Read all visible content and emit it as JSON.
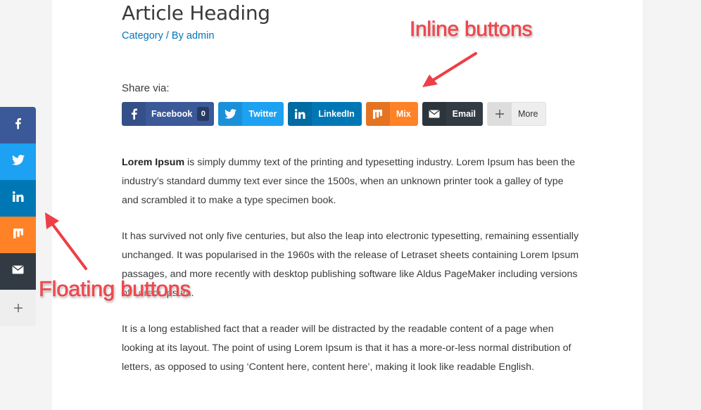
{
  "article": {
    "title": "Article Heading",
    "meta": {
      "category": "Category",
      "separator": " / By ",
      "author": "admin"
    },
    "share_label": "Share via:"
  },
  "inline_buttons": [
    {
      "name": "facebook",
      "label": "Facebook",
      "icon": "facebook-icon",
      "count": "0",
      "color": "#3b5998"
    },
    {
      "name": "twitter",
      "label": "Twitter",
      "icon": "twitter-icon",
      "color": "#1da1f2"
    },
    {
      "name": "linkedin",
      "label": "LinkedIn",
      "icon": "linkedin-icon",
      "color": "#0077b5"
    },
    {
      "name": "mix",
      "label": "Mix",
      "icon": "mix-icon",
      "color": "#ff8226"
    },
    {
      "name": "email",
      "label": "Email",
      "icon": "email-icon",
      "color": "#323b43"
    },
    {
      "name": "more",
      "label": "More",
      "icon": "plus-icon",
      "color": "#eeeeee"
    }
  ],
  "floating_buttons": [
    {
      "name": "facebook",
      "icon": "facebook-icon",
      "color": "#3b5998"
    },
    {
      "name": "twitter",
      "icon": "twitter-icon",
      "color": "#1da1f2"
    },
    {
      "name": "linkedin",
      "icon": "linkedin-icon",
      "color": "#0077b5"
    },
    {
      "name": "mix",
      "icon": "mix-icon",
      "color": "#ff8226"
    },
    {
      "name": "email",
      "icon": "email-icon",
      "color": "#323b43"
    },
    {
      "name": "more",
      "icon": "plus-icon",
      "color": "#eeeeee"
    }
  ],
  "paragraphs": [
    {
      "bold": "Lorem Ipsum",
      "text": " is simply dummy text of the printing and typesetting industry. Lorem Ipsum has been the industry’s standard dummy text ever since the 1500s, when an unknown printer took a galley of type and scrambled it to make a type specimen book."
    },
    {
      "text": "It has survived not only five centuries, but also the leap into electronic typesetting, remaining essentially unchanged. It was popularised in the 1960s with the release of Letraset sheets containing Lorem Ipsum passages, and more recently with desktop publishing software like Aldus PageMaker including versions of Lorem Ipsum."
    },
    {
      "text": "It is a long established fact that a reader will be distracted by the readable content of a page when looking at its layout. The point of using Lorem Ipsum is that it has a more-or-less normal distribution of letters, as opposed to using ‘Content here, content here’, making it look like readable English."
    }
  ],
  "annotations": {
    "inline": "Inline buttons",
    "floating": "Floating buttons",
    "color": "#f24a4f"
  }
}
